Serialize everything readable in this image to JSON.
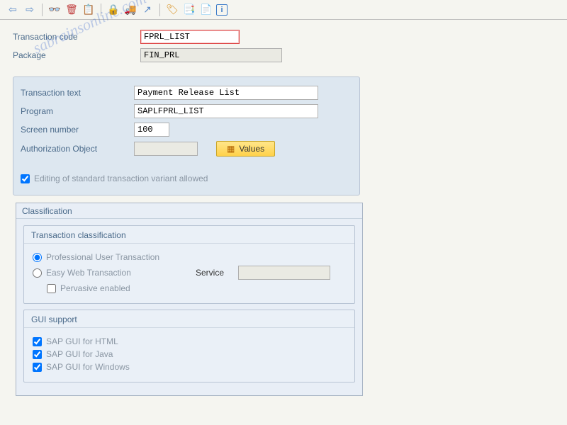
{
  "header": {
    "transaction_code_label": "Transaction code",
    "transaction_code_value": "FPRL_LIST",
    "package_label": "Package",
    "package_value": "FIN_PRL"
  },
  "details": {
    "transaction_text_label": "Transaction text",
    "transaction_text_value": "Payment Release List",
    "program_label": "Program",
    "program_value": "SAPLFPRL_LIST",
    "screen_number_label": "Screen number",
    "screen_number_value": "100",
    "auth_object_label": "Authorization Object",
    "auth_object_value": "",
    "values_button": "Values",
    "edit_variant_label": "Editing of standard transaction variant allowed"
  },
  "classification": {
    "group_label": "Classification",
    "trans_class_label": "Transaction classification",
    "professional_label": "Professional User Transaction",
    "easyweb_label": "Easy Web Transaction",
    "service_label": "Service",
    "service_value": "",
    "pervasive_label": "Pervasive enabled",
    "gui_support_label": "GUI support",
    "gui_html_label": "SAP GUI for HTML",
    "gui_java_label": "SAP GUI for Java",
    "gui_windows_label": "SAP GUI for Windows"
  },
  "watermark": "sabrainsonline.com"
}
